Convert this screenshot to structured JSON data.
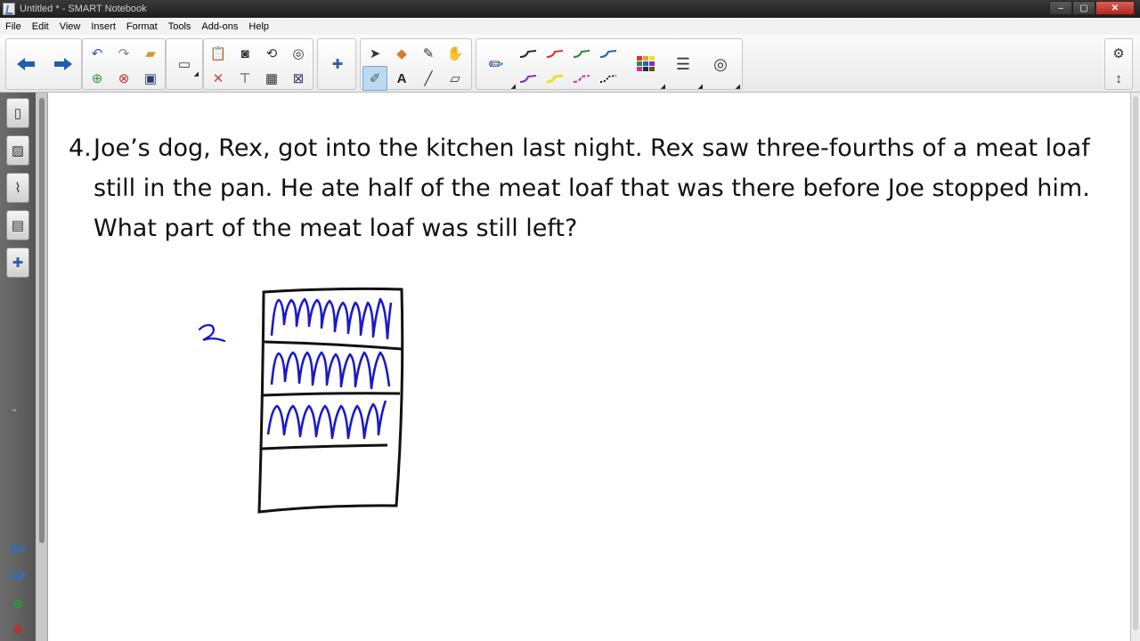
{
  "window": {
    "title": "Untitled * - SMART Notebook",
    "buttons": {
      "minimize": "–",
      "maximize": "▢",
      "close": "✕"
    }
  },
  "menu": [
    "File",
    "Edit",
    "View",
    "Insert",
    "Format",
    "Tools",
    "Add-ons",
    "Help"
  ],
  "toolbar": {
    "icons": {
      "back": "arrow-left-icon",
      "forward": "arrow-right-icon",
      "select": "arrow-pointer-icon",
      "pens": "pen-icon",
      "eraser": "eraser-icon",
      "line": "line-icon",
      "text": "text-icon",
      "magic_pen": "magic-pen-icon",
      "properties": "gear-icon"
    },
    "text_tool_label": "A",
    "pen_colors": [
      "#1f2a40",
      "#d23a2a",
      "#2f8a3a",
      "#2b5fb8",
      "#8b2fb8",
      "#e8e03a",
      "#d42ab0",
      "#111111"
    ]
  },
  "problem": {
    "number": "4.",
    "text": "Joe’s dog, Rex, got into the kitchen last night. Rex saw three-fourths of a meat loaf still in the pan. He ate half of the meat loaf that was there before Joe stopped him. What part of the meat loaf was still left?"
  },
  "annotation": {
    "handwritten": "2",
    "ink_color": "#1414c8"
  }
}
